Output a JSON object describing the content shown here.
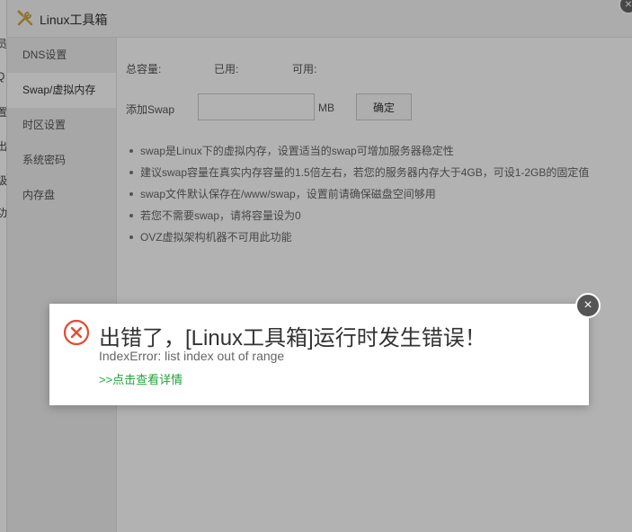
{
  "window": {
    "title": "Linux工具箱",
    "close_glyph": "×"
  },
  "background_strip": {
    "fragments": [
      "员",
      "Q",
      "置",
      "出",
      "级",
      "功"
    ]
  },
  "sidebar": {
    "items": [
      {
        "label": "DNS设置",
        "active": false
      },
      {
        "label": "Swap/虚拟内存",
        "active": true
      },
      {
        "label": "时区设置",
        "active": false
      },
      {
        "label": "系统密码",
        "active": false
      },
      {
        "label": "内存盘",
        "active": false
      }
    ]
  },
  "swap": {
    "total_label": "总容量:",
    "used_label": "已用:",
    "free_label": "可用:",
    "add_label": "添加Swap",
    "input_value": "",
    "unit": "MB",
    "confirm_label": "确定"
  },
  "tips": [
    "swap是Linux下的虚拟内存，设置适当的swap可增加服务器稳定性",
    "建议swap容量在真实内存容量的1.5倍左右，若您的服务器内存大于4GB，可设1-2GB的固定值",
    "swap文件默认保存在/www/swap，设置前请确保磁盘空间够用",
    "若您不需要swap，请将容量设为0",
    "OVZ虚拟架构机器不可用此功能"
  ],
  "error_dialog": {
    "title": "出错了，[Linux工具箱]运行时发生错误！",
    "message": "IndexError: list index out of range",
    "details_link": ">>点击查看详情",
    "close_glyph": "×",
    "icon": "error-circle-icon",
    "icon_color": "#e8492e",
    "link_color": "#20a53a"
  }
}
